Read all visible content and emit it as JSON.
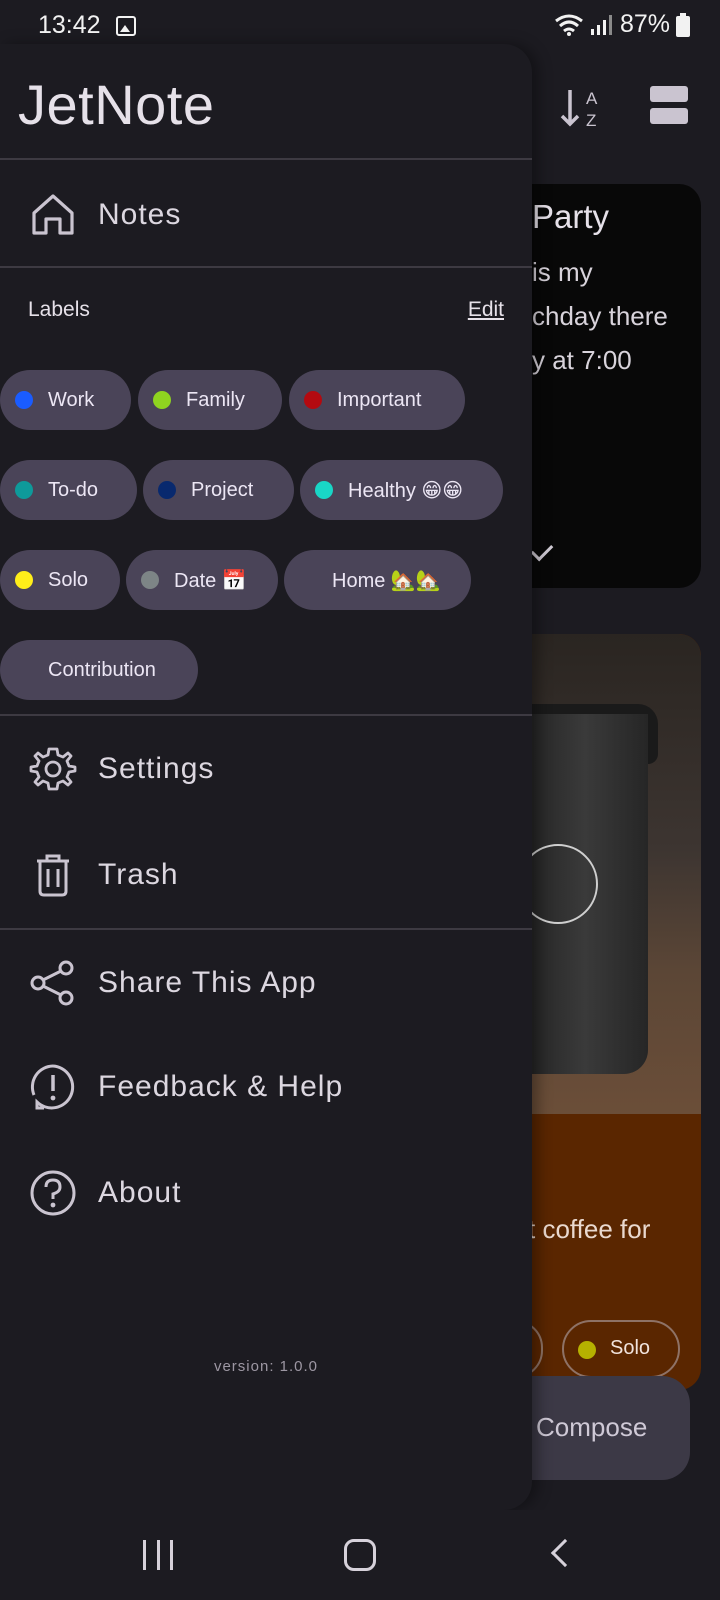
{
  "status_bar": {
    "time": "13:42",
    "battery": "87%",
    "icons": [
      "gallery-icon",
      "wifi-icon",
      "signal-icon",
      "battery-icon"
    ]
  },
  "background": {
    "note1_title": "Party",
    "note1_body": "is my\nchday there\ny at 7:00",
    "note2_text": "t coffee for",
    "note2_chip": "Solo",
    "compose_label": "Compose"
  },
  "drawer": {
    "title": "JetNote",
    "notes_label": "Notes",
    "labels_title": "Labels",
    "labels_edit": "Edit",
    "labels": [
      {
        "name": "Work",
        "color": "#1a5cff"
      },
      {
        "name": "Family",
        "color": "#8fd320"
      },
      {
        "name": "Important",
        "color": "#b30a10"
      },
      {
        "name": "To-do",
        "color": "#0e9a9a"
      },
      {
        "name": "Project",
        "color": "#08296e"
      },
      {
        "name": "Healthy 😁😁",
        "color": "#19d6c6"
      },
      {
        "name": "Solo",
        "color": "#ffee1a"
      },
      {
        "name": "Date 📅",
        "color": "#7d8586"
      },
      {
        "name": "Home 🏡🏡",
        "color": ""
      },
      {
        "name": "Contribution",
        "color": ""
      }
    ],
    "settings_label": "Settings",
    "trash_label": "Trash",
    "share_label": "Share This App",
    "feedback_label": "Feedback & Help",
    "about_label": "About",
    "version": "version: 1.0.0"
  }
}
